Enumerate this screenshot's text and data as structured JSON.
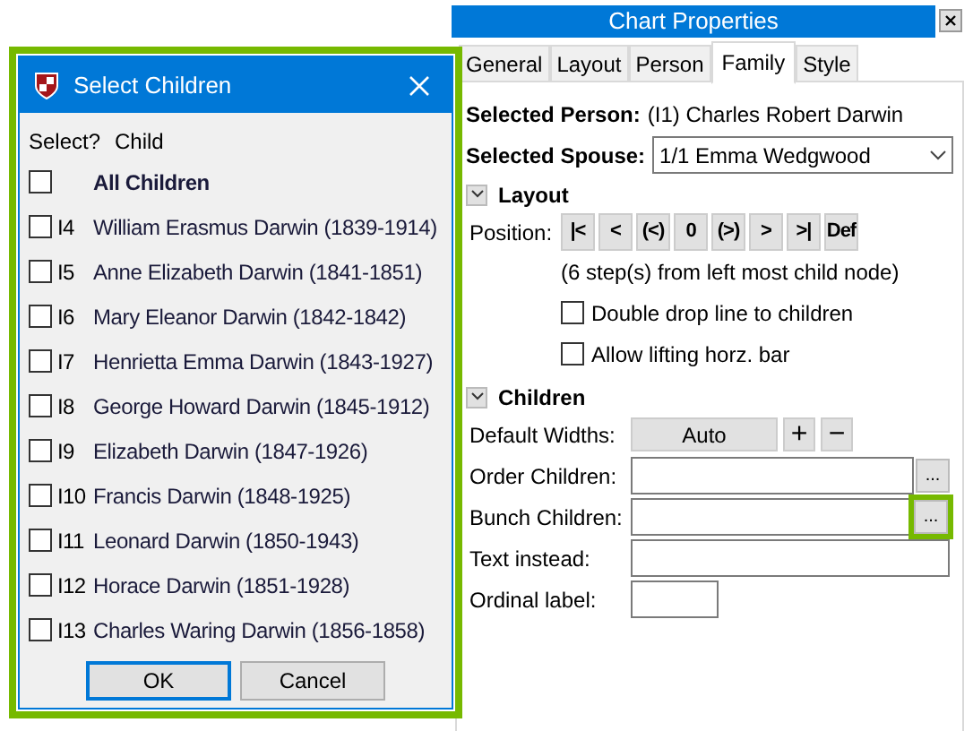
{
  "dialog": {
    "title": "Select Children",
    "highlighted": true,
    "header": [
      "Select?",
      "Child"
    ],
    "rows": [
      {
        "kind": "all",
        "id": "",
        "name": "All Children",
        "checked": false
      },
      {
        "kind": "child",
        "id": "I4",
        "name": "William Erasmus Darwin (1839-1914)",
        "checked": false
      },
      {
        "kind": "child",
        "id": "I5",
        "name": "Anne Elizabeth Darwin (1841-1851)",
        "checked": false
      },
      {
        "kind": "child",
        "id": "I6",
        "name": "Mary Eleanor Darwin (1842-1842)",
        "checked": false
      },
      {
        "kind": "child",
        "id": "I7",
        "name": "Henrietta Emma Darwin (1843-1927)",
        "checked": false
      },
      {
        "kind": "child",
        "id": "I8",
        "name": "George Howard Darwin (1845-1912)",
        "checked": false
      },
      {
        "kind": "child",
        "id": "I9",
        "name": "Elizabeth Darwin (1847-1926)",
        "checked": false
      },
      {
        "kind": "child",
        "id": "I10",
        "name": "Francis Darwin (1848-1925)",
        "checked": false
      },
      {
        "kind": "child",
        "id": "I11",
        "name": "Leonard Darwin (1850-1943)",
        "checked": false
      },
      {
        "kind": "child",
        "id": "I12",
        "name": "Horace Darwin (1851-1928)",
        "checked": false
      },
      {
        "kind": "child",
        "id": "I13",
        "name": "Charles Waring Darwin (1856-1858)",
        "checked": false
      }
    ],
    "buttons": [
      {
        "label": "OK",
        "default": true
      },
      {
        "label": "Cancel",
        "default": false
      }
    ]
  },
  "properties": {
    "title": "Chart Properties",
    "tabs": [
      {
        "label": "General",
        "selected": false
      },
      {
        "label": "Layout",
        "selected": false
      },
      {
        "label": "Person",
        "selected": false
      },
      {
        "label": "Family",
        "selected": true
      },
      {
        "label": "Style",
        "selected": false
      }
    ],
    "selected_person": {
      "label": "Selected Person:",
      "value": "(I1) Charles Robert Darwin"
    },
    "selected_spouse": {
      "label": "Selected Spouse:",
      "value": "1/1 Emma Wedgwood"
    },
    "layout": {
      "title": "Layout",
      "expanded": true,
      "position_label": "Position:",
      "position_buttons": [
        "|<",
        "<",
        "(<)",
        "0",
        "(>)",
        ">",
        ">|",
        "Def"
      ],
      "note": "(6 step(s) from left most child node)",
      "options": [
        {
          "label": "Double drop line to children",
          "checked": false
        },
        {
          "label": "Allow lifting horz. bar",
          "checked": false
        }
      ]
    },
    "children": {
      "title": "Children",
      "expanded": true,
      "default_widths_label": "Default Widths:",
      "auto_button": "Auto",
      "plus": "+",
      "minus": "−",
      "fields": [
        {
          "kind": "browse",
          "label": "Order Children:",
          "button": "...",
          "highlighted": false
        },
        {
          "kind": "browse",
          "label": "Bunch Children:",
          "button": "...",
          "highlighted": true
        },
        {
          "kind": "wide",
          "label": "Text instead:"
        },
        {
          "kind": "short",
          "label": "Ordinal label:"
        }
      ]
    }
  }
}
